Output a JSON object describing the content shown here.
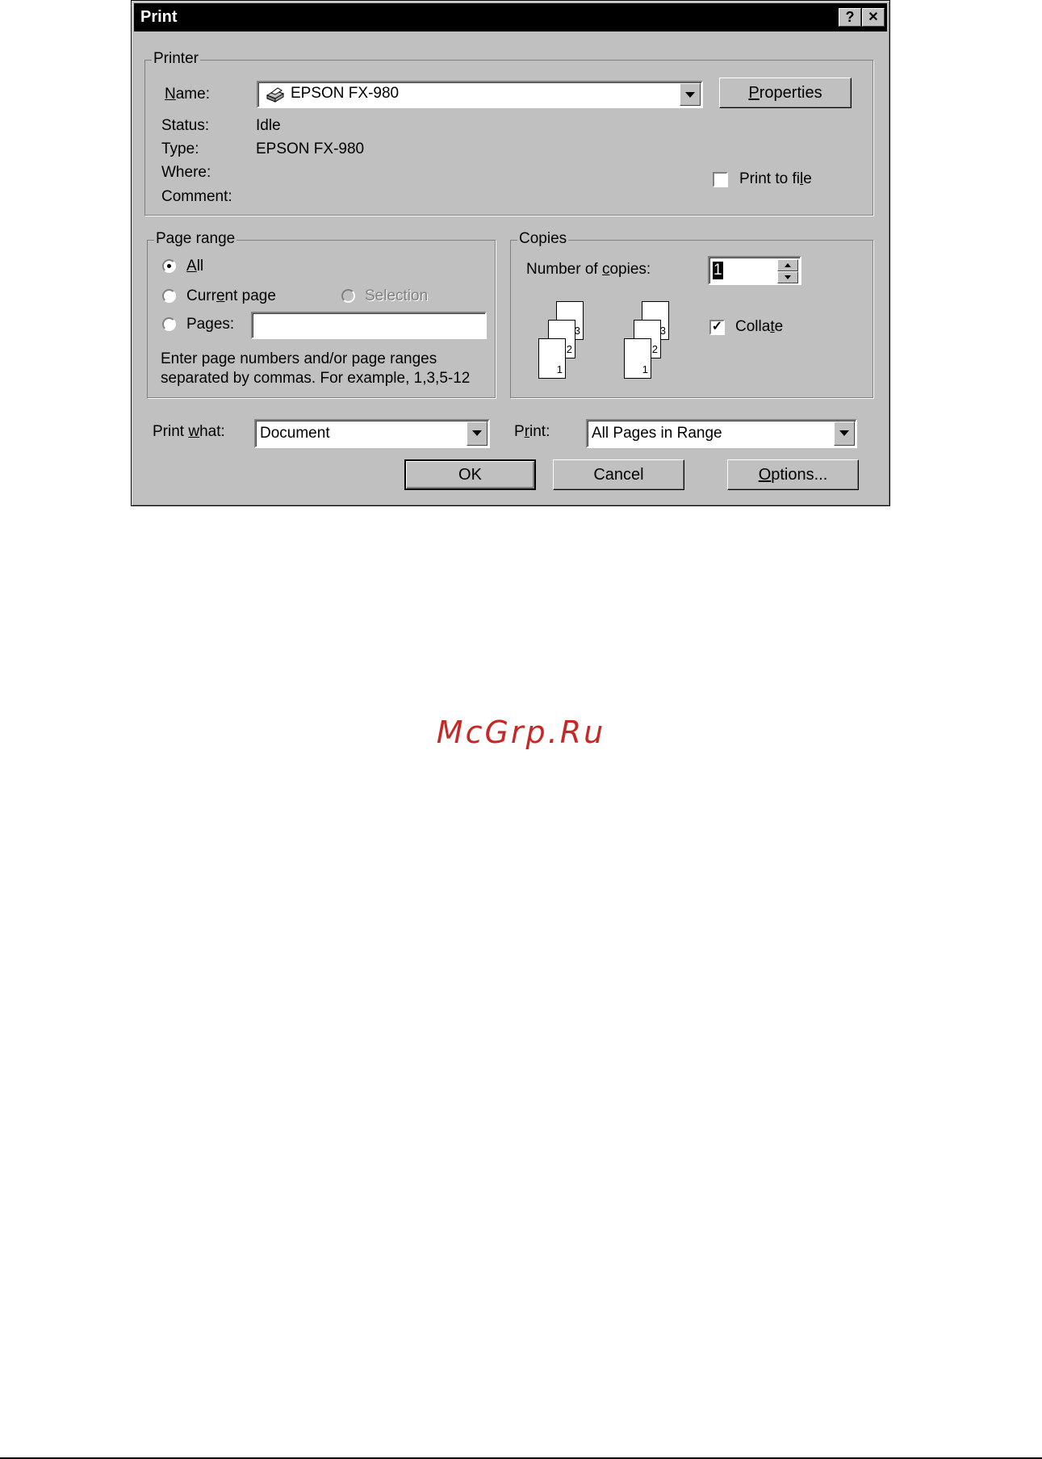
{
  "dialog": {
    "title": "Print",
    "help_button": "?",
    "close_button": "✕"
  },
  "printer": {
    "group_label": "Printer",
    "name_label": "Name:",
    "name_value": "EPSON FX-980",
    "properties_button": "Properties",
    "status_label": "Status:",
    "status_value": "Idle",
    "type_label": "Type:",
    "type_value": "EPSON FX-980",
    "where_label": "Where:",
    "comment_label": "Comment:",
    "print_to_file_label": "Print to file",
    "print_to_file_checked": false
  },
  "page_range": {
    "group_label": "Page range",
    "all_label": "All",
    "current_page_label": "Current page",
    "selection_label": "Selection",
    "pages_label": "Pages:",
    "pages_value": "",
    "hint_line1": "Enter page numbers and/or page ranges",
    "hint_line2": "separated by commas.  For example, 1,3,5-12",
    "selected": "All"
  },
  "copies": {
    "group_label": "Copies",
    "number_label": "Number of copies:",
    "number_value": "1",
    "collate_label": "Collate",
    "collate_checked": true,
    "page_numbers": [
      "1",
      "2",
      "3"
    ]
  },
  "footer": {
    "print_what_label": "Print what:",
    "print_what_value": "Document",
    "print_label": "Print:",
    "print_value": "All Pages in Range",
    "ok_button": "OK",
    "cancel_button": "Cancel",
    "options_button": "Options..."
  },
  "watermark": "McGrp.Ru",
  "colors": {
    "dialog_bg": "#c0c0c0",
    "titlebar_bg": "#000000",
    "watermark": "#c62828"
  }
}
